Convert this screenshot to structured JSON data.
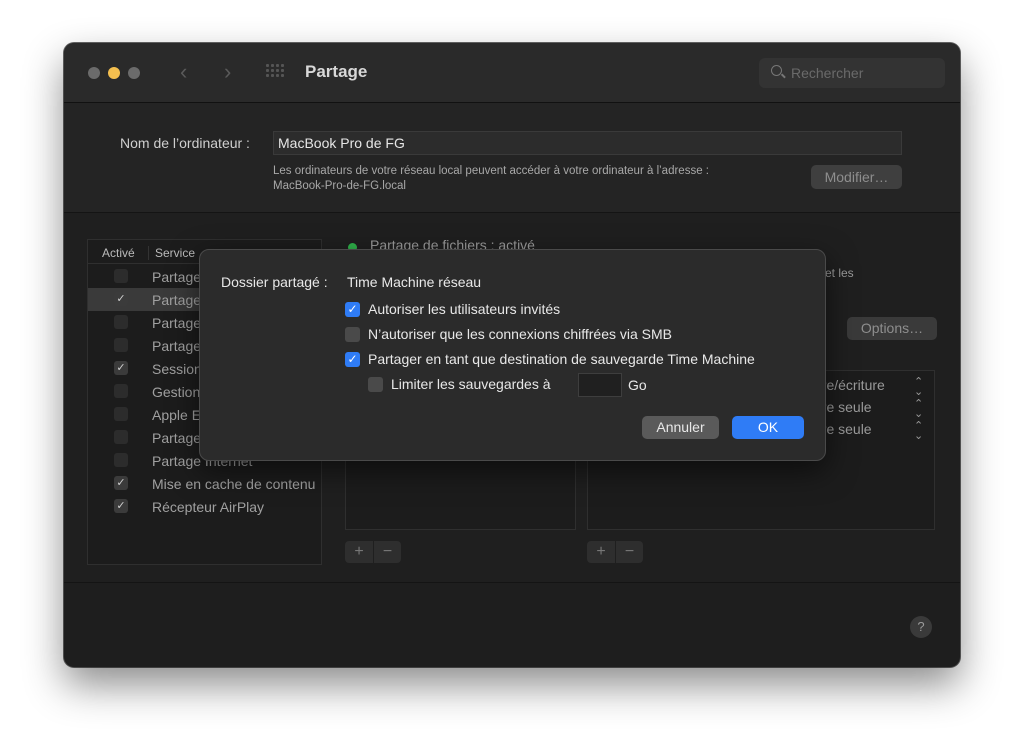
{
  "window": {
    "title": "Partage",
    "search_placeholder": "Rechercher"
  },
  "computer": {
    "name_label": "Nom de l’ordinateur :",
    "name_value": "MacBook Pro de FG",
    "address_text_line1": "Les ordinateurs de votre réseau local peuvent accéder à votre ordinateur à l’adresse :",
    "address_text_line2": "MacBook-Pro-de-FG.local",
    "modify_button": "Modifier…"
  },
  "services": {
    "header_active": "Activé",
    "header_service": "Service",
    "items": [
      {
        "label": "Partage d’écran",
        "checked": false
      },
      {
        "label": "Partage de fichiers",
        "checked": true,
        "selected": true
      },
      {
        "label": "Partage de médias",
        "checked": false
      },
      {
        "label": "Partage d’imprimantes",
        "checked": false
      },
      {
        "label": "Session à distance",
        "checked": true
      },
      {
        "label": "Gestion à distance",
        "checked": false
      },
      {
        "label": "Apple Events à distance",
        "checked": false
      },
      {
        "label": "Partage Bluetooth",
        "checked": false
      },
      {
        "label": "Partage Internet",
        "checked": false
      },
      {
        "label": "Mise en cache de contenu",
        "checked": true
      },
      {
        "label": "Récepteur AirPlay",
        "checked": true
      }
    ]
  },
  "file_sharing": {
    "status": "Partage de fichiers : activé",
    "side_text": "et les",
    "options_button": "Options…",
    "permissions": [
      "ure/écriture",
      "ure seule",
      "ure seule"
    ],
    "add_symbol": "+",
    "remove_symbol": "−"
  },
  "sheet": {
    "shared_folder_label": "Dossier partagé :",
    "shared_folder_value": "Time Machine réseau",
    "options": [
      {
        "label": "Autoriser les utilisateurs invités",
        "checked": true
      },
      {
        "label": "N’autoriser que les connexions chiffrées via SMB",
        "checked": false
      },
      {
        "label": "Partager en tant que destination de sauvegarde Time Machine",
        "checked": true
      },
      {
        "label": "Limiter les sauvegardes à",
        "checked": false
      }
    ],
    "limit_value": "",
    "limit_unit": "Go",
    "cancel_button": "Annuler",
    "ok_button": "OK"
  },
  "help": "?",
  "colors": {
    "accent": "#2f7cf6",
    "status_green": "#2fb24a",
    "traffic_yellow": "#f4bf4f"
  }
}
